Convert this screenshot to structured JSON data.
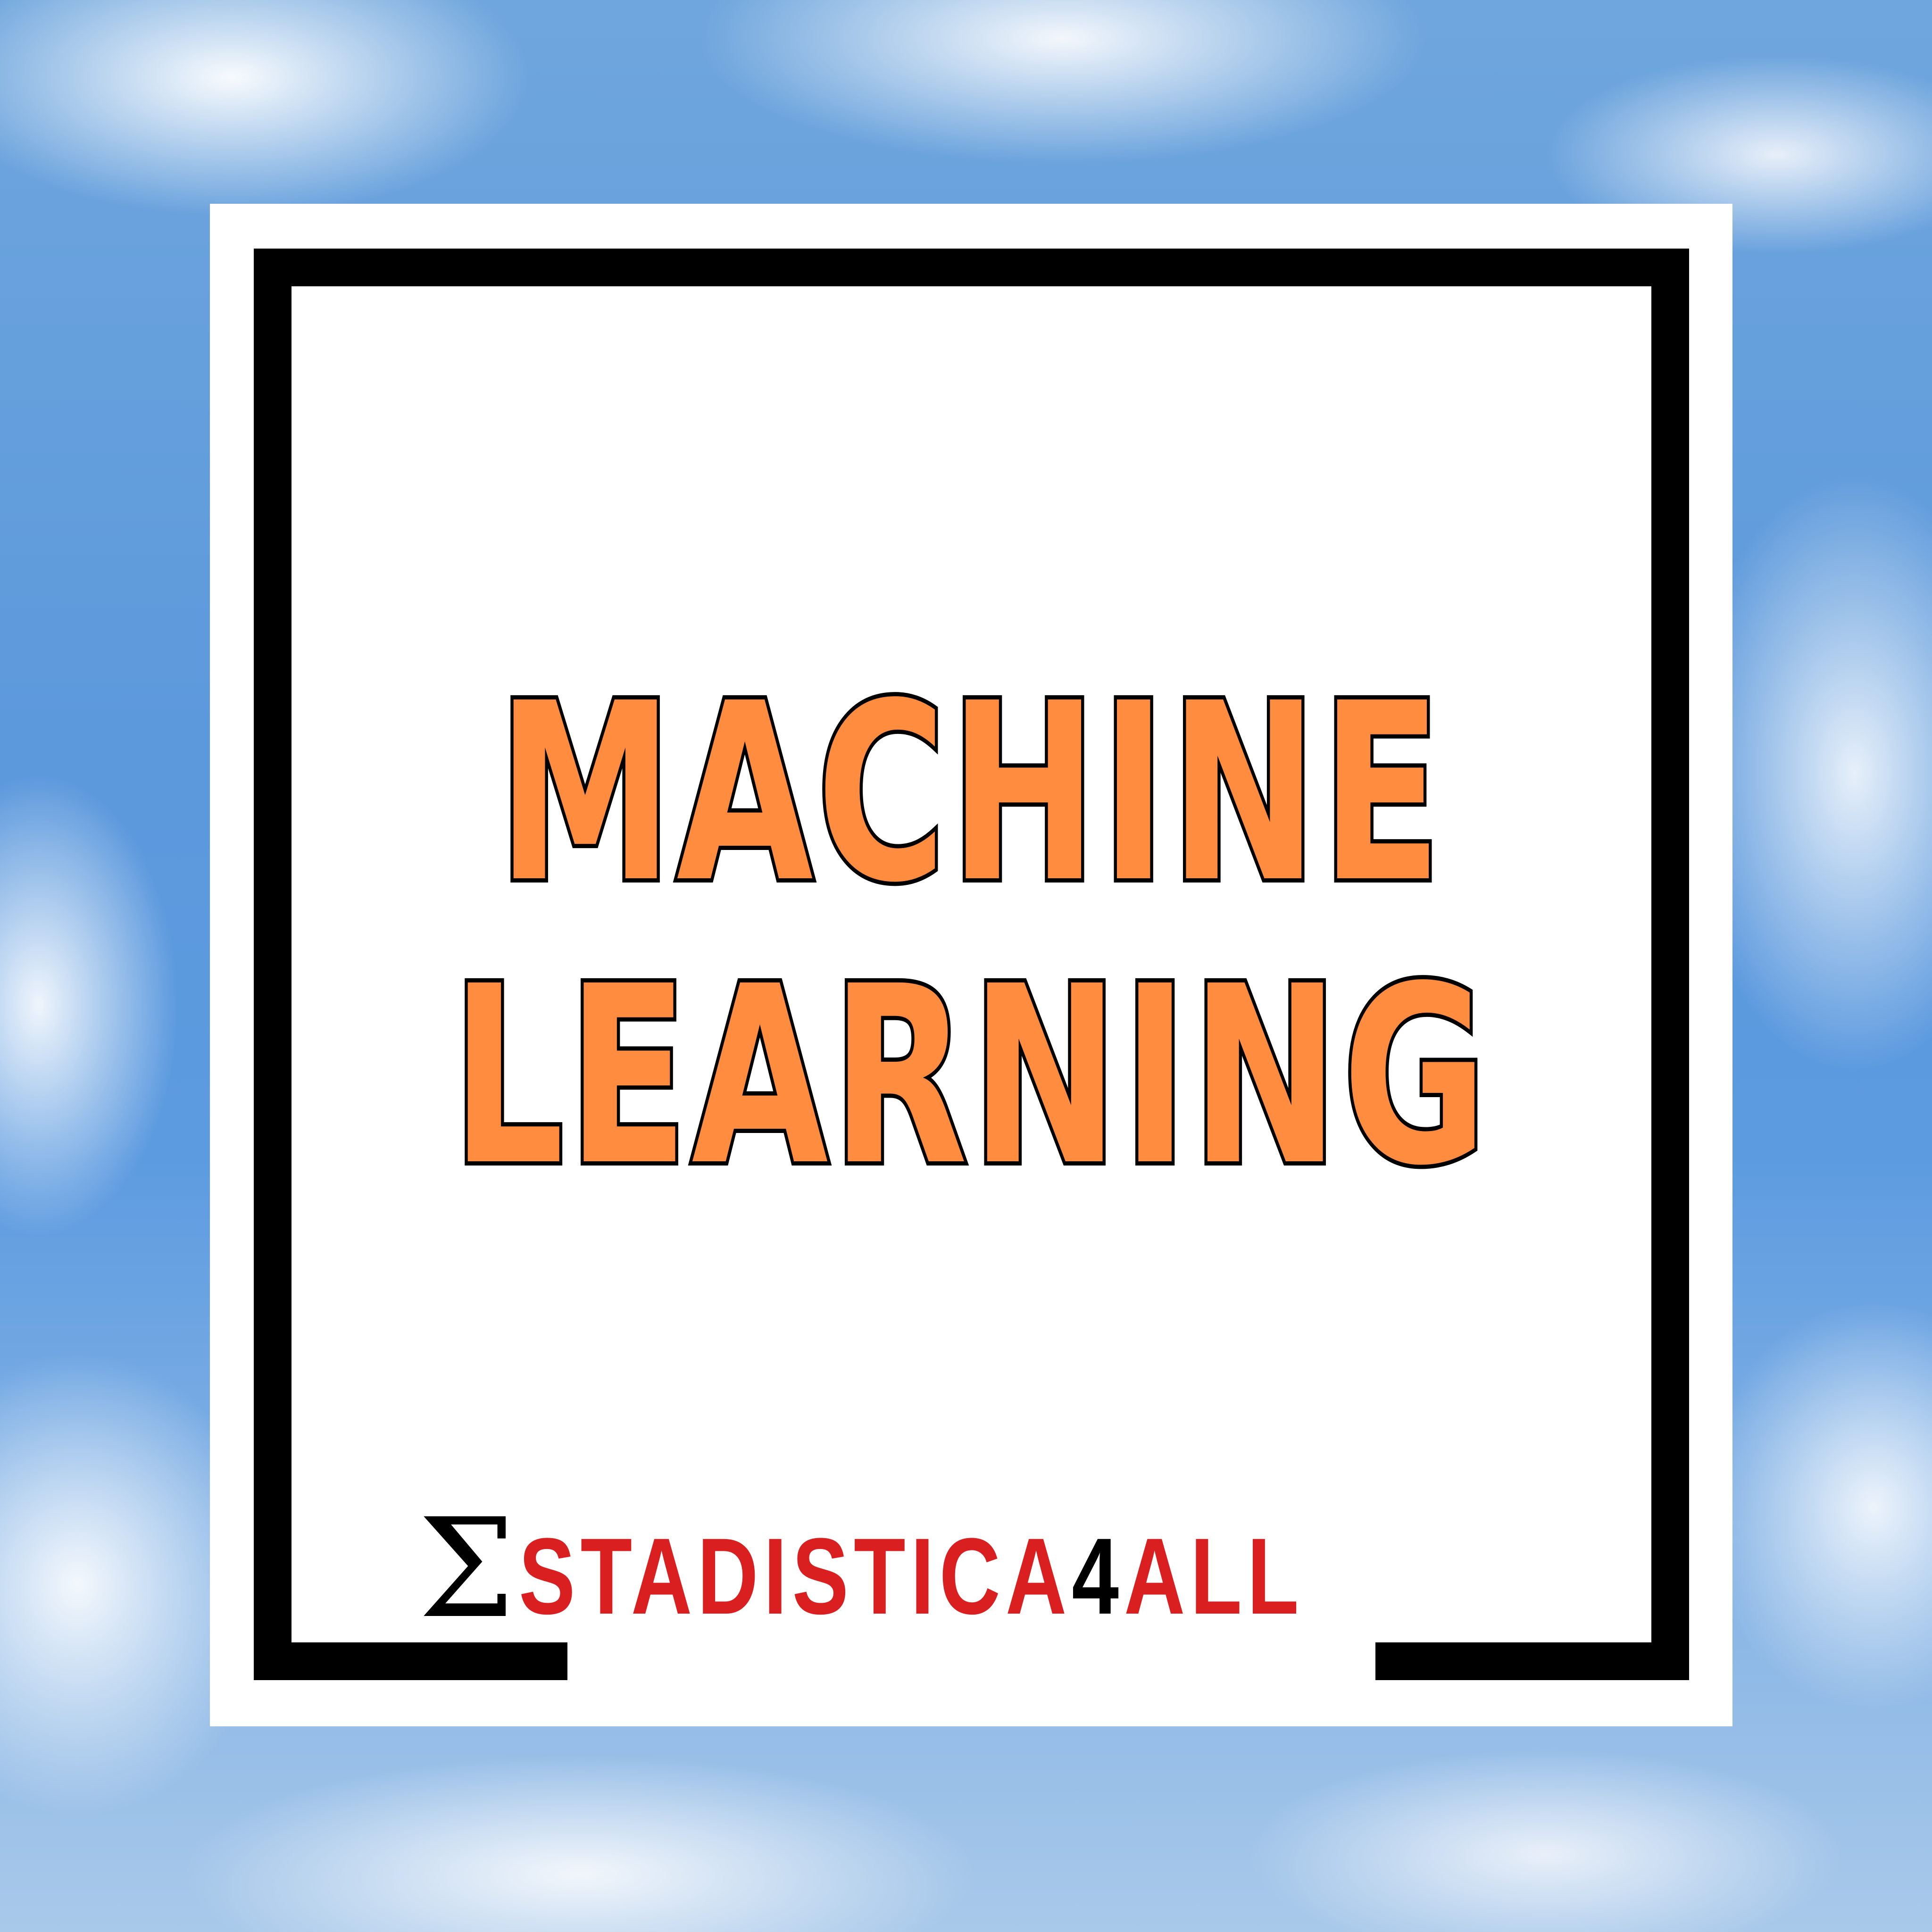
{
  "title": {
    "line1": "MACHINE",
    "line2": "LEARNING"
  },
  "logo": {
    "symbol": "Σ",
    "text_part1": "STADISTICA",
    "text_number": "4",
    "text_part2": "ALL"
  },
  "colors": {
    "title_fill": "#ff8c3f",
    "title_outline": "#000000",
    "logo_red": "#d91f1f",
    "frame": "#000000",
    "card": "#ffffff",
    "sky": "#5d9be0"
  },
  "background": "blurred-sky-with-clouds"
}
